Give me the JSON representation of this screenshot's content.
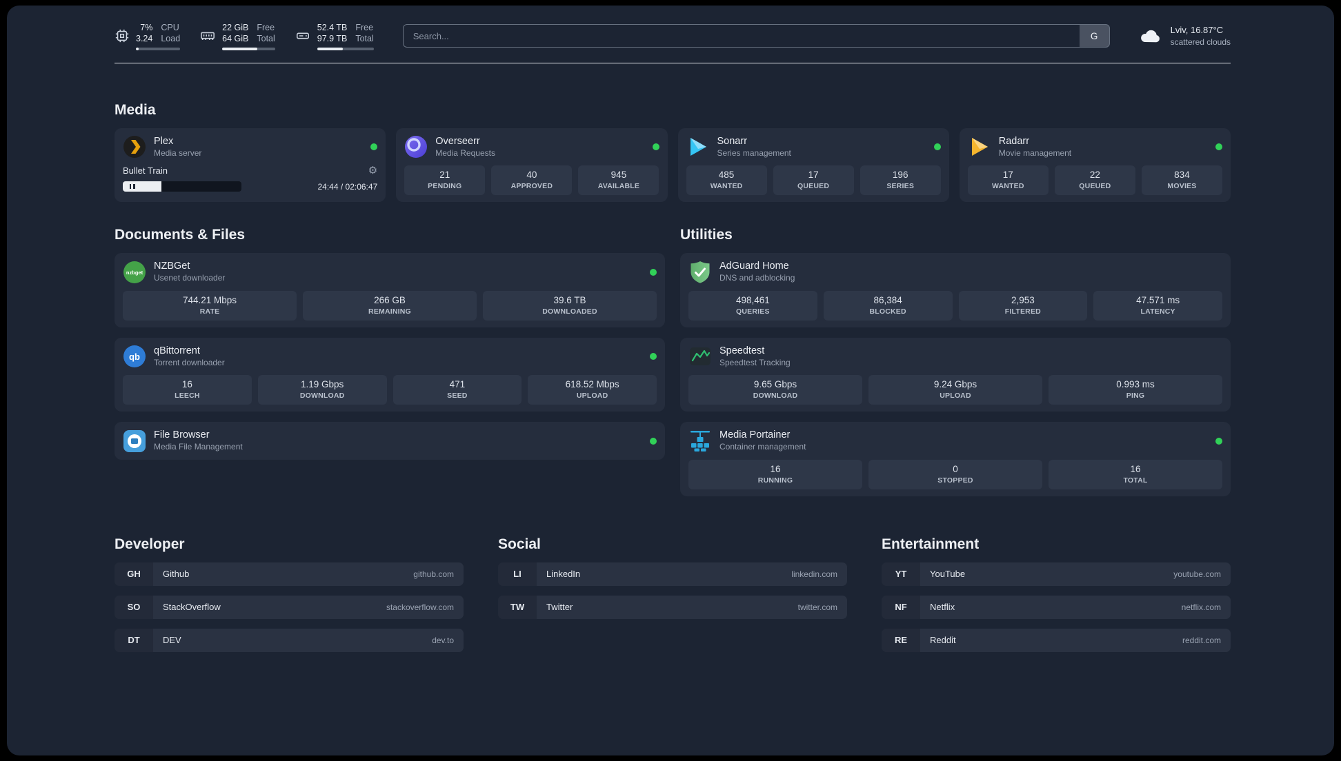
{
  "colors": {
    "status_online": "#31d158",
    "accent_green": "#2fbf71",
    "panel_bg": "#1c2433"
  },
  "topbar": {
    "cpu": {
      "top_value": "7%",
      "bottom_value": "3.24",
      "top_label": "CPU",
      "bottom_label": "Load",
      "percent": 7
    },
    "ram": {
      "top_value": "22 GiB",
      "bottom_value": "64 GiB",
      "top_label": "Free",
      "bottom_label": "Total",
      "percent": 66
    },
    "disk": {
      "top_value": "52.4 TB",
      "bottom_value": "97.9 TB",
      "top_label": "Free",
      "bottom_label": "Total",
      "percent": 46
    },
    "search": {
      "placeholder": "Search...",
      "provider": "G"
    },
    "weather": {
      "location": "Lviv, 16.87°C",
      "condition": "scattered clouds"
    }
  },
  "media": {
    "heading": "Media",
    "plex": {
      "name": "Plex",
      "desc": "Media server",
      "now_playing": "Bullet Train",
      "time": "24:44 / 02:06:47",
      "progress_percent": 20
    },
    "overseerr": {
      "name": "Overseerr",
      "desc": "Media Requests",
      "stats": [
        {
          "value": "21",
          "label": "PENDING"
        },
        {
          "value": "40",
          "label": "APPROVED"
        },
        {
          "value": "945",
          "label": "AVAILABLE"
        }
      ]
    },
    "sonarr": {
      "name": "Sonarr",
      "desc": "Series management",
      "stats": [
        {
          "value": "485",
          "label": "WANTED"
        },
        {
          "value": "17",
          "label": "QUEUED"
        },
        {
          "value": "196",
          "label": "SERIES"
        }
      ]
    },
    "radarr": {
      "name": "Radarr",
      "desc": "Movie management",
      "stats": [
        {
          "value": "17",
          "label": "WANTED"
        },
        {
          "value": "22",
          "label": "QUEUED"
        },
        {
          "value": "834",
          "label": "MOVIES"
        }
      ]
    }
  },
  "documents": {
    "heading": "Documents & Files",
    "nzbget": {
      "name": "NZBGet",
      "desc": "Usenet downloader",
      "stats": [
        {
          "value": "744.21 Mbps",
          "label": "RATE"
        },
        {
          "value": "266 GB",
          "label": "REMAINING"
        },
        {
          "value": "39.6 TB",
          "label": "DOWNLOADED"
        }
      ]
    },
    "qbittorrent": {
      "name": "qBittorrent",
      "desc": "Torrent downloader",
      "stats": [
        {
          "value": "16",
          "label": "LEECH"
        },
        {
          "value": "1.19 Gbps",
          "label": "DOWNLOAD"
        },
        {
          "value": "471",
          "label": "SEED"
        },
        {
          "value": "618.52 Mbps",
          "label": "UPLOAD"
        }
      ]
    },
    "filebrowser": {
      "name": "File Browser",
      "desc": "Media File Management"
    }
  },
  "utilities": {
    "heading": "Utilities",
    "adguard": {
      "name": "AdGuard Home",
      "desc": "DNS and adblocking",
      "stats": [
        {
          "value": "498,461",
          "label": "QUERIES"
        },
        {
          "value": "86,384",
          "label": "BLOCKED"
        },
        {
          "value": "2,953",
          "label": "FILTERED"
        },
        {
          "value": "47.571 ms",
          "label": "LATENCY"
        }
      ]
    },
    "speedtest": {
      "name": "Speedtest",
      "desc": "Speedtest Tracking",
      "stats": [
        {
          "value": "9.65 Gbps",
          "label": "DOWNLOAD"
        },
        {
          "value": "9.24 Gbps",
          "label": "UPLOAD"
        },
        {
          "value": "0.993 ms",
          "label": "PING"
        }
      ]
    },
    "portainer": {
      "name": "Media Portainer",
      "desc": "Container management",
      "stats": [
        {
          "value": "16",
          "label": "RUNNING"
        },
        {
          "value": "0",
          "label": "STOPPED"
        },
        {
          "value": "16",
          "label": "TOTAL"
        }
      ]
    }
  },
  "bookmarks": {
    "developer": {
      "heading": "Developer",
      "items": [
        {
          "abbr": "GH",
          "name": "Github",
          "url": "github.com"
        },
        {
          "abbr": "SO",
          "name": "StackOverflow",
          "url": "stackoverflow.com"
        },
        {
          "abbr": "DT",
          "name": "DEV",
          "url": "dev.to"
        }
      ]
    },
    "social": {
      "heading": "Social",
      "items": [
        {
          "abbr": "LI",
          "name": "LinkedIn",
          "url": "linkedin.com"
        },
        {
          "abbr": "TW",
          "name": "Twitter",
          "url": "twitter.com"
        }
      ]
    },
    "entertainment": {
      "heading": "Entertainment",
      "items": [
        {
          "abbr": "YT",
          "name": "YouTube",
          "url": "youtube.com"
        },
        {
          "abbr": "NF",
          "name": "Netflix",
          "url": "netflix.com"
        },
        {
          "abbr": "RE",
          "name": "Reddit",
          "url": "reddit.com"
        }
      ]
    }
  }
}
